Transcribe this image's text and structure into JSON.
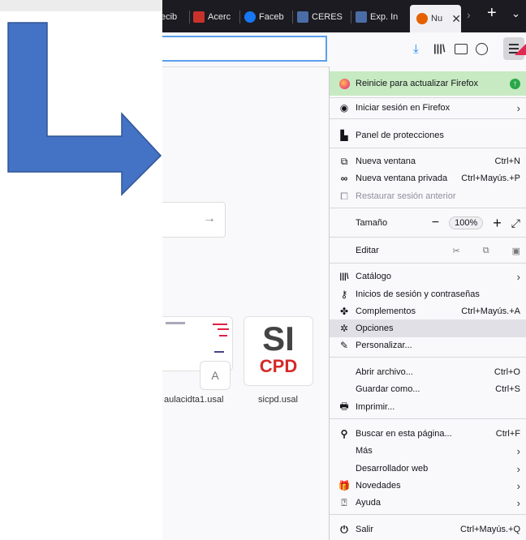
{
  "tabs": [
    {
      "label": "ecib"
    },
    {
      "label": "Acerc"
    },
    {
      "label": "Faceb"
    },
    {
      "label": "CERES"
    },
    {
      "label": "Exp. In"
    },
    {
      "label": "Nu"
    }
  ],
  "tab_controls": {
    "new_tab": "+"
  },
  "newtab_page": {
    "search_arrow": "→",
    "tiles": [
      {
        "label": "aulacidta1.usal",
        "badge": "A"
      },
      {
        "label": "sicpd.usal",
        "logo_top": "SI",
        "logo_bottom": "CPD"
      }
    ]
  },
  "menu": {
    "update": "Reinicie para actualizar Firefox",
    "signin": "Iniciar sesión en Firefox",
    "protections": "Panel de protecciones",
    "new_window": {
      "label": "Nueva ventana",
      "shortcut": "Ctrl+N"
    },
    "private_window": {
      "label": "Nueva ventana privada",
      "shortcut": "Ctrl+Mayús.+P"
    },
    "restore_session": "Restaurar sesión anterior",
    "zoom": {
      "label": "Tamaño",
      "value": "100%",
      "minus": "−",
      "plus": "+"
    },
    "edit": {
      "label": "Editar"
    },
    "library": "Catálogo",
    "logins": "Inicios de sesión y contraseñas",
    "addons": {
      "label": "Complementos",
      "shortcut": "Ctrl+Mayús.+A"
    },
    "options": "Opciones",
    "customize": "Personalizar...",
    "open_file": {
      "label": "Abrir archivo...",
      "shortcut": "Ctrl+O"
    },
    "save_as": {
      "label": "Guardar como...",
      "shortcut": "Ctrl+S"
    },
    "print": "Imprimir...",
    "find": {
      "label": "Buscar en esta página...",
      "shortcut": "Ctrl+F"
    },
    "more": "Más",
    "webdev": "Desarrollador web",
    "whats_new": "Novedades",
    "help": "Ayuda",
    "quit": {
      "label": "Salir",
      "shortcut": "Ctrl+Mayús.+Q"
    }
  },
  "colors": {
    "arrow": "#4472c4",
    "update_bg": "#c7eac2",
    "highlight": "#e0e0e6",
    "update_icon": "#2ba84a"
  }
}
